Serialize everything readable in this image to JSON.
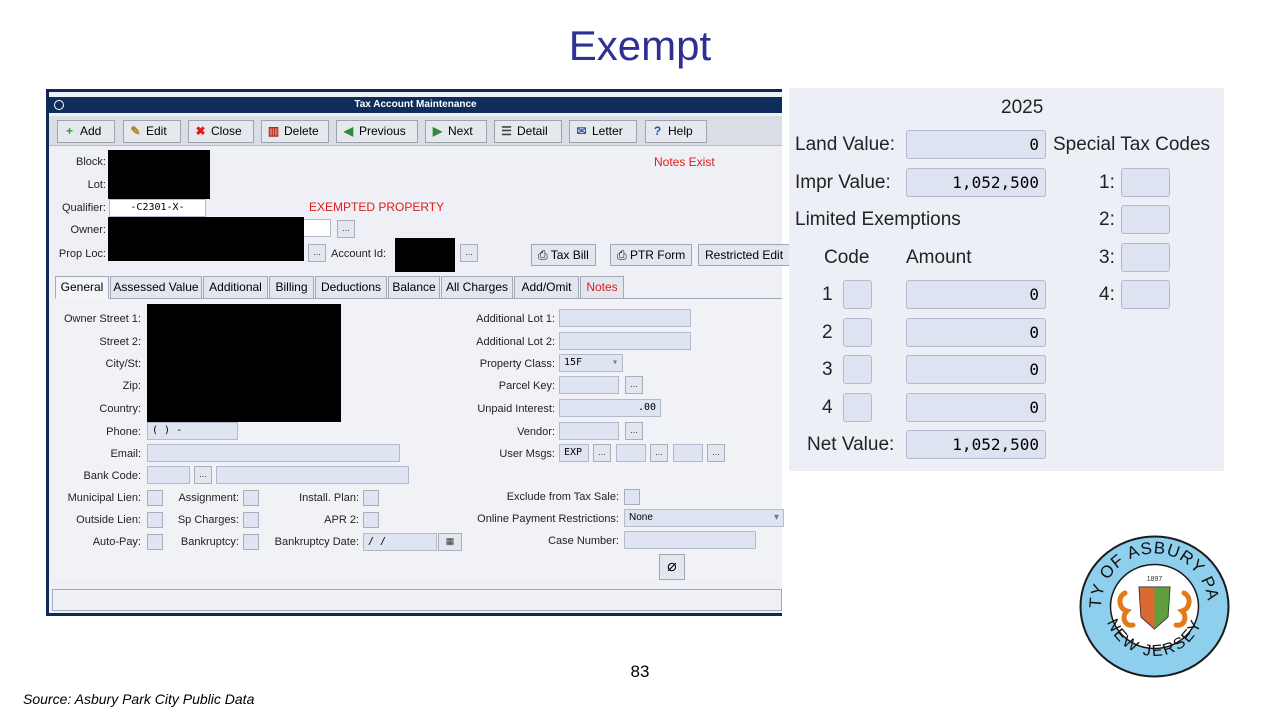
{
  "slide": {
    "title": "Exempt",
    "page_number": "83",
    "source": "Source: Asbury Park City Public Data",
    "seal_text": "CITY OF ASBURY PARK NEW JERSEY 1897"
  },
  "window": {
    "title": "Tax Account Maintenance",
    "toolbar": [
      {
        "icon": "add-icon",
        "label": "Add"
      },
      {
        "icon": "edit-icon",
        "label": "Edit"
      },
      {
        "icon": "close-icon",
        "label": "Close"
      },
      {
        "icon": "trash-icon",
        "label": "Delete"
      },
      {
        "icon": "previous-icon",
        "label": "Previous"
      },
      {
        "icon": "next-icon",
        "label": "Next"
      },
      {
        "icon": "detail-icon",
        "label": "Detail"
      },
      {
        "icon": "letter-icon",
        "label": "Letter"
      },
      {
        "icon": "help-icon",
        "label": "Help"
      }
    ],
    "header": {
      "block_label": "Block:",
      "lot_label": "Lot:",
      "qualifier_label": "Qualifier:",
      "qualifier_value": "-C2301-X-",
      "owner_label": "Owner:",
      "prop_loc_label": "Prop Loc:",
      "account_id_label": "Account Id:",
      "notes_exist": "Notes Exist",
      "exempted": "EXEMPTED PROPERTY",
      "ellipsis": "..."
    },
    "actions": {
      "tax_bill": "Tax Bill",
      "ptr_form": "PTR Form",
      "restricted_edit": "Restricted Edit"
    },
    "tabs": [
      "General",
      "Assessed Value",
      "Additional",
      "Billing",
      "Deductions",
      "Balance",
      "All Charges",
      "Add/Omit",
      "Notes"
    ],
    "general": {
      "owner_street1": "Owner Street 1:",
      "street2": "Street 2:",
      "city_st": "City/St:",
      "zip": "Zip:",
      "country": "Country:",
      "phone_label": "Phone:",
      "phone_value": "(   )   -",
      "email": "Email:",
      "bank_code": "Bank Code:",
      "municipal_lien": "Municipal Lien:",
      "assignment": "Assignment:",
      "install_plan": "Install. Plan:",
      "outside_lien": "Outside Lien:",
      "sp_charges": "Sp Charges:",
      "apr2": "APR 2:",
      "auto_pay": "Auto-Pay:",
      "bankruptcy": "Bankruptcy:",
      "bankruptcy_date": "Bankruptcy Date:",
      "bankruptcy_date_value": "/   /",
      "additional_lot1": "Additional Lot 1:",
      "additional_lot2": "Additional Lot 2:",
      "property_class_label": "Property Class:",
      "property_class_value": "15F",
      "parcel_key": "Parcel Key:",
      "unpaid_interest_label": "Unpaid Interest:",
      "unpaid_interest_value": ".00",
      "vendor": "Vendor:",
      "user_msgs_label": "User Msgs:",
      "user_msgs_value": "EXP",
      "exclude_tax_sale": "Exclude from Tax Sale:",
      "online_payment_label": "Online Payment Restrictions:",
      "online_payment_value": "None",
      "case_number": "Case Number:"
    }
  },
  "assessment": {
    "year": "2025",
    "land_label": "Land Value:",
    "land_value": "0",
    "impr_label": "Impr Value:",
    "impr_value": "1,052,500",
    "limited_exemptions": "Limited Exemptions",
    "code_header": "Code",
    "amount_header": "Amount",
    "exemptions": [
      {
        "num": "1",
        "amount": "0"
      },
      {
        "num": "2",
        "amount": "0"
      },
      {
        "num": "3",
        "amount": "0"
      },
      {
        "num": "4",
        "amount": "0"
      }
    ],
    "net_label": "Net Value:",
    "net_value": "1,052,500",
    "special_tax_codes": "Special Tax Codes",
    "special_codes": [
      "1:",
      "2:",
      "3:",
      "4:"
    ]
  }
}
